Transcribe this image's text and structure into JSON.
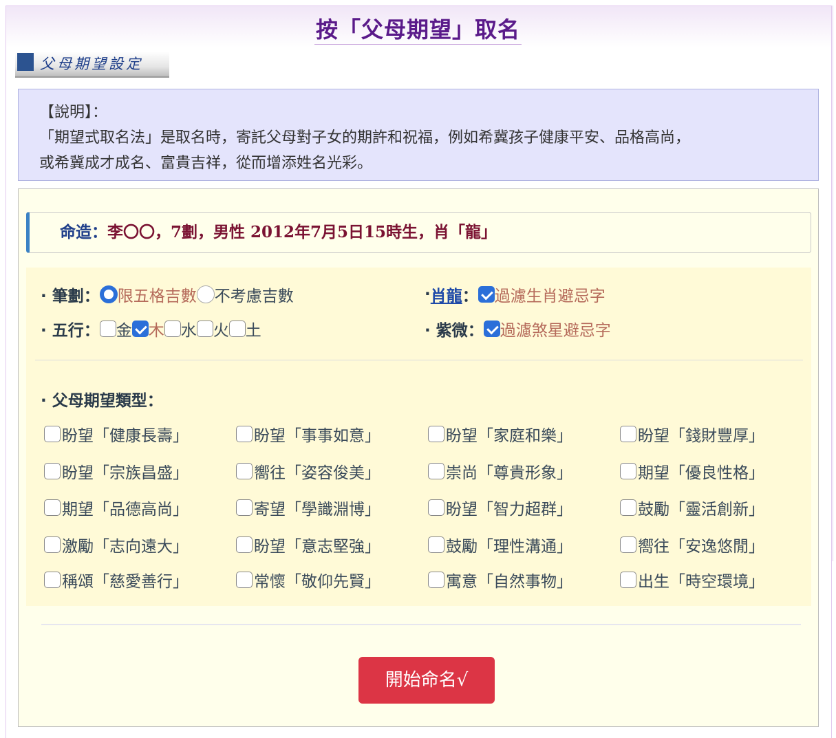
{
  "title": "按「父母期望」取名",
  "section_banner": "父母期望設定",
  "intro": {
    "heading": "【說明】：",
    "line1": "「期望式取名法」是取名時，寄託父母對子女的期許和祝福，例如希冀孩子健康平安、品格高尚，",
    "line2": "或希冀成才成名、富貴吉祥，從而增添姓名光彩。"
  },
  "destiny": {
    "label": "命造：",
    "name": "李〇〇，7劃，男性",
    "birth": "2012年7月5日15時生，肖「龍」"
  },
  "options": {
    "strokes": {
      "label": "· 筆劃：",
      "choices": [
        "限五格吉數",
        "不考慮吉數"
      ],
      "selected": "限五格吉數"
    },
    "zodiac": {
      "label_prefix": "· ",
      "link": "肖龍",
      "label_suffix": "：",
      "checkbox_label": "過濾生肖避忌字",
      "checked": true
    },
    "elements": {
      "label": "· 五行：",
      "items": [
        {
          "label": "金",
          "checked": false
        },
        {
          "label": "木",
          "checked": true
        },
        {
          "label": "水",
          "checked": false
        },
        {
          "label": "火",
          "checked": false
        },
        {
          "label": "土",
          "checked": false
        }
      ]
    },
    "ziwei": {
      "label": "· 紫微：",
      "checkbox_label": "過濾煞星避忌字",
      "checked": true
    }
  },
  "types": {
    "label": "· 父母期望類型：",
    "items": [
      "盼望「健康長壽」",
      "盼望「事事如意」",
      "盼望「家庭和樂」",
      "盼望「錢財豐厚」",
      "盼望「宗族昌盛」",
      "嚮往「姿容俊美」",
      "崇尚「尊貴形象」",
      "期望「優良性格」",
      "期望「品德高尚」",
      "寄望「學識淵博」",
      "盼望「智力超群」",
      "鼓勵「靈活創新」",
      "激勵「志向遠大」",
      "盼望「意志堅強」",
      "鼓勵「理性溝通」",
      "嚮往「安逸悠閒」",
      "稱頌「慈愛善行」",
      "常懷「敬仰先賢」",
      "寓意「自然事物」",
      "出生「時空環境」"
    ]
  },
  "start_button": "開始命名√",
  "colors": {
    "title": "#5a1a8a",
    "button": "#dc3545",
    "checkbox_checked": "#2b6fd9",
    "intro_bg": "#e4e4fc",
    "form_bg": "#ffffeb",
    "options_bg": "#fffad7"
  }
}
